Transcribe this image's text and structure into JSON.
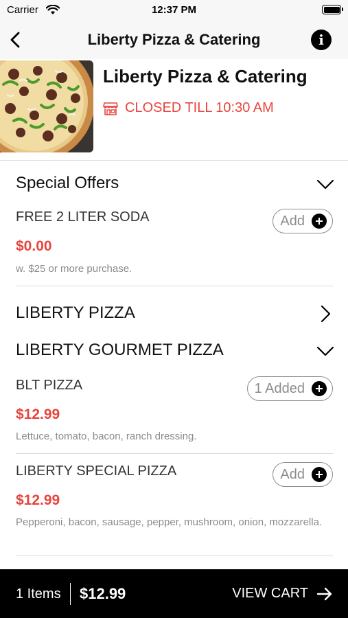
{
  "status": {
    "carrier": "Carrier",
    "time": "12:37 PM"
  },
  "nav": {
    "title": "Liberty Pizza & Catering"
  },
  "restaurant": {
    "name": "Liberty Pizza & Catering",
    "status": "CLOSED TILL 10:30 AM"
  },
  "sections": [
    {
      "title": "Special Offers",
      "items": [
        {
          "name": "FREE 2 LITER SODA",
          "price": "$0.00",
          "description": "w. $25 or more purchase.",
          "button": "Add"
        }
      ]
    },
    {
      "title": "LIBERTY PIZZA"
    },
    {
      "title": "LIBERTY GOURMET PIZZA",
      "items": [
        {
          "name": "BLT PIZZA",
          "price": "$12.99",
          "description": "Lettuce, tomato, bacon, ranch dressing.",
          "button": "1 Added"
        },
        {
          "name": "LIBERTY SPECIAL PIZZA",
          "price": "$12.99",
          "description": "Pepperoni, bacon, sausage, pepper, mushroom, onion, mozzarella.",
          "button": "Add"
        }
      ]
    }
  ],
  "cart": {
    "count": "1 Items",
    "total": "$12.99",
    "action": "VIEW CART"
  },
  "colors": {
    "accent": "#e8443d",
    "cart_bar": "#000000",
    "nav_bg": "#f7f7f7"
  }
}
